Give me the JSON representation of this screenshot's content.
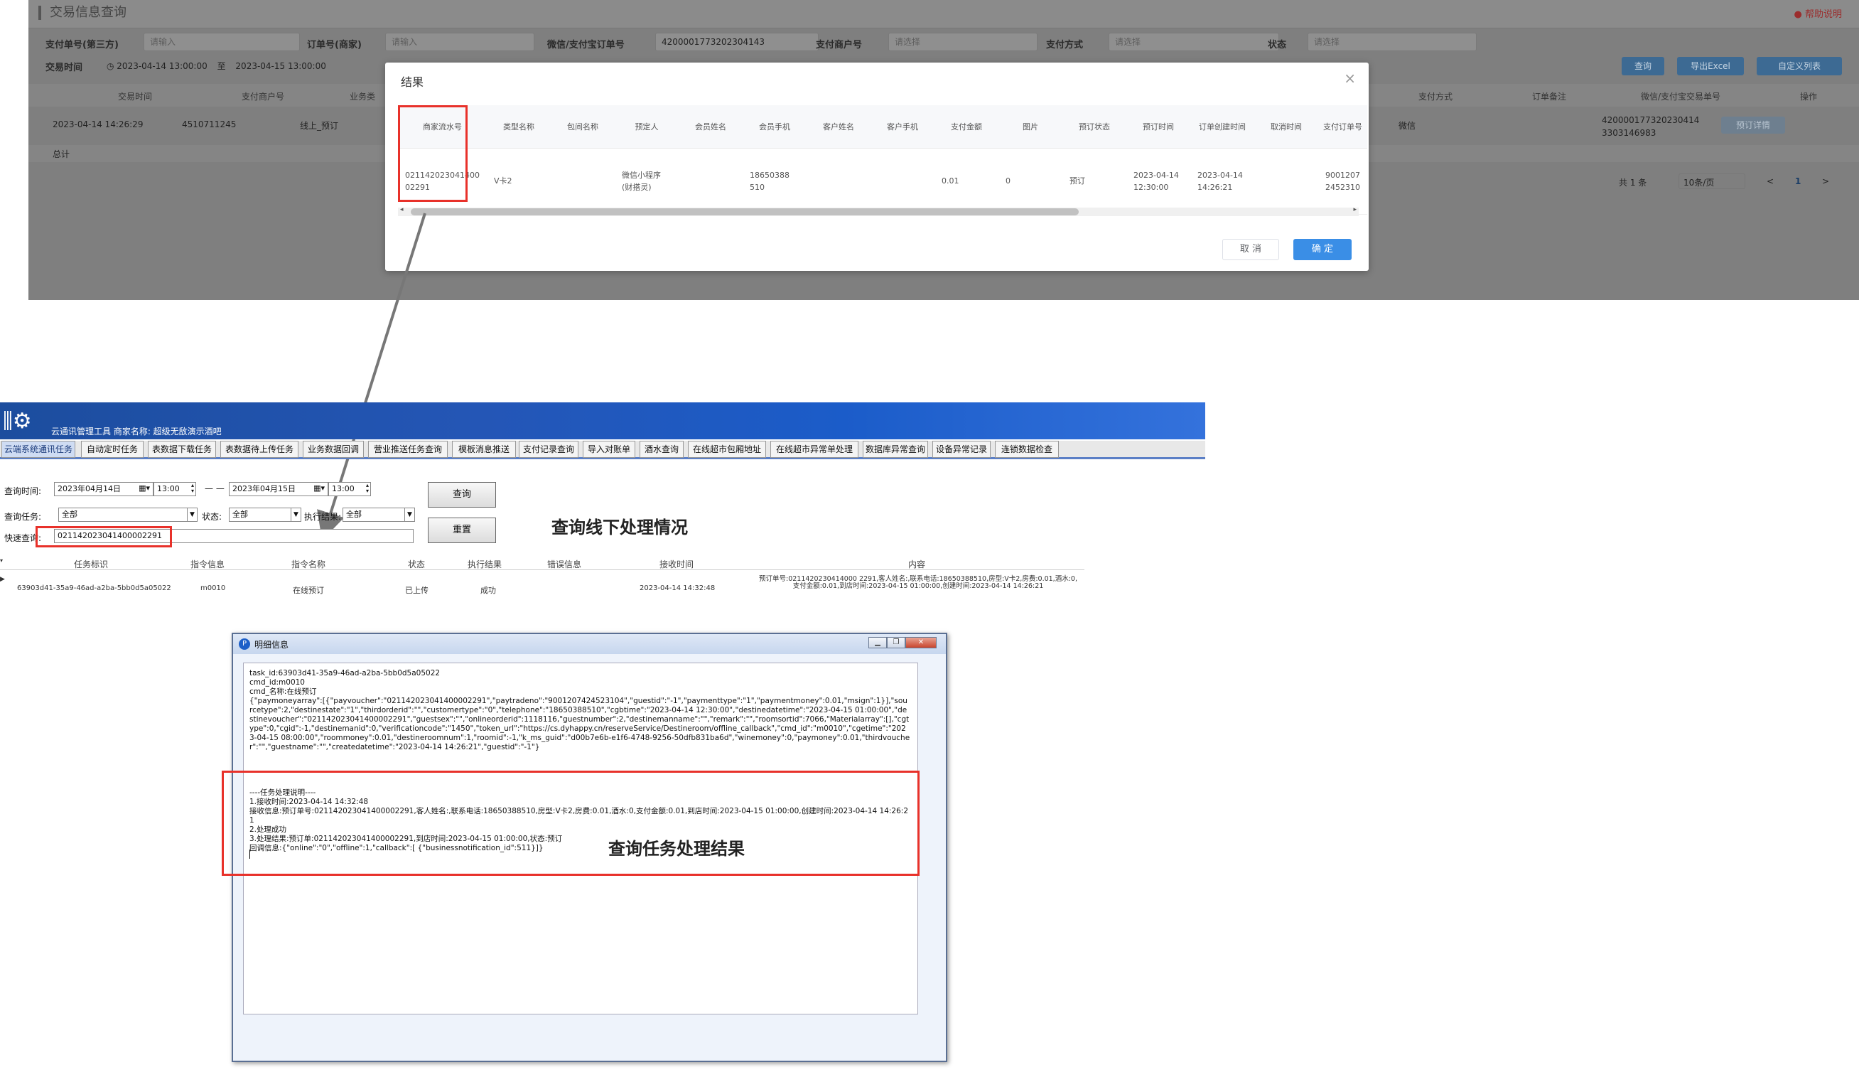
{
  "web": {
    "page_title": "交易信息查询",
    "help_link": "帮助说明",
    "filters": {
      "pay_no_label": "支付单号(第三方)",
      "pay_no_placeholder": "请输入",
      "order_no_label": "订单号(商家)",
      "order_no_placeholder": "请输入",
      "wx_label": "微信/支付宝订单号",
      "wx_value": "4200001773202304143",
      "merchant_label": "支付商户号",
      "merchant_placeholder": "请选择",
      "pay_method_label": "支付方式",
      "pay_method_placeholder": "请选择",
      "status_label": "状态",
      "status_placeholder": "请选择",
      "time_label": "交易时间",
      "time_from": "2023-04-14 13:00:00",
      "time_sep": "至",
      "time_to": "2023-04-15 13:00:00"
    },
    "buttons": {
      "query": "查询",
      "export": "导出Excel",
      "custom": "自定义列表"
    },
    "table_headers": [
      "交易时间",
      "支付商户号",
      "业务类",
      "支付方式",
      "订单备注",
      "微信/支付宝交易单号",
      "操作"
    ],
    "row": {
      "time": "2023-04-14 14:26:29",
      "merchant": "4510711245",
      "biz": "线上_预订",
      "pay": "微信",
      "trade_no": "420000177320230414 3303146983",
      "action": "预订详情"
    },
    "sum_label": "总计",
    "pagination": {
      "total": "共 1 条",
      "page_size": "10条/页",
      "prev": "<",
      "page": "1",
      "next": ">"
    }
  },
  "dialog": {
    "title": "结果",
    "close": "×",
    "headers": [
      "商家流水号",
      "类型名称",
      "包间名称",
      "预定人",
      "会员姓名",
      "会员手机",
      "客户姓名",
      "客户手机",
      "支付金额",
      "图片",
      "预订状态",
      "预订时间",
      "订单创建时间",
      "取消时间",
      "支付订单号"
    ],
    "row": [
      "021142023041400 02291",
      "V卡2",
      "",
      "微信小程序(财搭灵)",
      "",
      "18650388 510",
      "",
      "",
      "0.01",
      "0",
      "预订",
      "2023-04-14 12:30:00",
      "2023-04-14 14:26:21",
      "",
      "9001207 2452310"
    ],
    "cancel": "取 消",
    "ok": "确 定"
  },
  "app": {
    "title": "云通讯管理工具  商家名称: 超级无敌演示酒吧",
    "tabs": [
      "云端系统通讯任务",
      "自动定时任务",
      "表数据下载任务",
      "表数据待上传任务",
      "业务数据回调",
      "营业推送任务查询",
      "模板消息推送",
      "支付记录查询",
      "导入对账单",
      "酒水查询",
      "在线超市包厢地址",
      "在线超市异常单处理",
      "数据库异常查询",
      "设备异常记录",
      "连锁数据检查"
    ],
    "form": {
      "time_label": "查询时间:",
      "date_from": "2023年04月14日",
      "time_from": "13:00",
      "sep": "— —",
      "date_to": "2023年04月15日",
      "time_to": "13:00",
      "task_label": "查询任务:",
      "task_value": "全部",
      "status_label": "状态:",
      "status_value": "全部",
      "result_label": "执行结果:",
      "result_value": "全部",
      "quick_label": "快速查询:",
      "quick_value": "021142023041400002291",
      "query_btn": "查询",
      "reset_btn": "重置"
    },
    "annotation": "查询线下处理情况",
    "grid_headers": [
      "任务标识",
      "指令信息",
      "指令名称",
      "状态",
      "执行结果",
      "错误信息",
      "接收时间",
      "内容"
    ],
    "grid_row": {
      "id": "63903d41-35a9-46ad-a2ba-5bb0d5a05022",
      "cmd": "m0010",
      "name": "在线预订",
      "status": "已上传",
      "result": "成功",
      "error": "",
      "time": "2023-04-14 14:32:48",
      "content": "预订单号:0211420230414000 2291,客人姓名:,联系电话:18650388510,房型:V卡2,房费:0.01,酒水:0,支付金额:0.01,到店时间:2023-04-15 01:00:00,创建时间:2023-04-14 14:26:21"
    }
  },
  "detail": {
    "title": "明细信息",
    "text1": "task_id:63903d41-35a9-46ad-a2ba-5bb0d5a05022\ncmd_id:m0010\ncmd_名称:在线预订\n{\"paymoneyarray\":[{\"payvoucher\":\"021142023041400002291\",\"paytradeno\":\"9001207424523104\",\"guestid\":\"-1\",\"paymenttype\":\"1\",\"paymentmoney\":0.01,\"msign\":1}],\"sourcetype\":2,\"destinestate\":\"1\",\"thirdorderid\":\"\",\"customertype\":\"0\",\"telephone\":\"18650388510\",\"cgbtime\":\"2023-04-14 12:30:00\",\"destinedatetime\":\"2023-04-15 01:00:00\",\"destinevoucher\":\"021142023041400002291\",\"guestsex\":\"\",\"onlineorderid\":1118116,\"guestnumber\":2,\"destinemanname\":\"\",\"remark\":\"\",\"roomsortid\":7066,\"Materialarray\":[],\"cgtype\":0,\"cgid\":-1,\"destinemanid\":0,\"verificationcode\":\"1450\",\"token_url\":\"https://cs.dyhappy.cn/reserveService/Destineroom/offline_callback\",\"cmd_id\":\"m0010\",\"cgetime\":\"2023-04-15 08:00:00\",\"roommoney\":0.01,\"destineroomnum\":1,\"roomid\":-1,\"k_ms_guid\":\"d00b7e6b-e1f6-4748-9256-50dfb831ba6d\",\"winemoney\":0,\"paymoney\":0.01,\"thirdvoucher\":\"\",\"guestname\":\"\",\"createdatetime\":\"2023-04-14 14:26:21\",\"guestid\":\"-1\"}",
    "text2": "----任务处理说明----\n1.接收时间:2023-04-14 14:32:48\n接收信息:预订单号:021142023041400002291,客人姓名:,联系电话:18650388510,房型:V卡2,房费:0.01,酒水:0,支付金额:0.01,到店时间:2023-04-15 01:00:00,创建时间:2023-04-14 14:26:21\n2.处理成功\n3.处理结果:预订单:021142023041400002291,到店时间:2023-04-15 01:00:00,状态:预订\n回调信息:{\"online\":\"0\",\"offline\":1,\"callback\":[ {\"businessnotification_id\":511}]}",
    "annotation": "查询任务处理结果"
  },
  "colors": {
    "accent_red": "#e8312a",
    "app_blue": "#1c4d9e",
    "primary_btn": "#3a8ee6"
  }
}
